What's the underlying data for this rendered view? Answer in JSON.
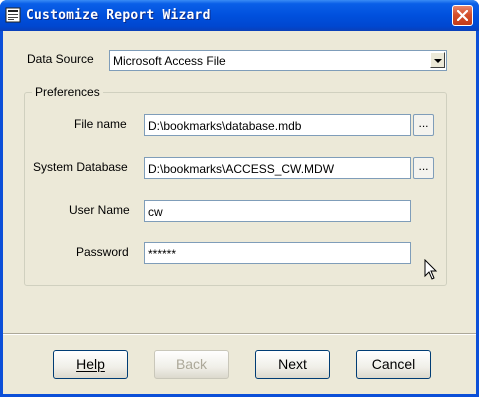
{
  "window": {
    "title": "Customize Report Wizard",
    "close_label": "×"
  },
  "data_source": {
    "label": "Data Source",
    "value": "Microsoft Access File"
  },
  "preferences": {
    "title": "Preferences",
    "file_name": {
      "label": "File name",
      "value": "D:\\bookmarks\\database.mdb",
      "browse": "..."
    },
    "system_database": {
      "label": "System Database",
      "value": "D:\\bookmarks\\ACCESS_CW.MDW",
      "browse": "..."
    },
    "user_name": {
      "label": "User Name",
      "value": "cw"
    },
    "password": {
      "label": "Password",
      "value": "******"
    }
  },
  "buttons": {
    "help": "Help",
    "back": "Back",
    "next": "Next",
    "cancel": "Cancel"
  }
}
